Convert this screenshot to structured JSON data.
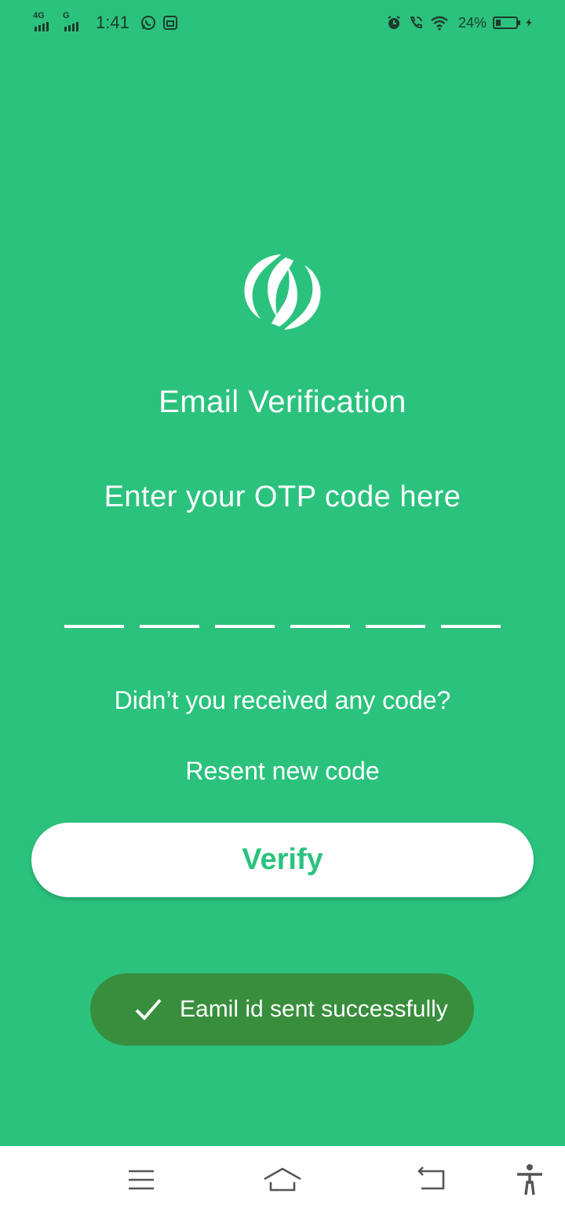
{
  "status_bar": {
    "network_1": "4G",
    "network_2": "G",
    "time": "1:41",
    "battery_percent": "24%",
    "battery_level": 0.24,
    "icons": [
      "whatsapp-icon",
      "message-icon",
      "alarm-icon",
      "wifi-call-icon",
      "wifi-icon",
      "battery-icon",
      "charging-icon"
    ]
  },
  "main": {
    "logo": "app-logo",
    "title": "Email Verification",
    "subtitle": "Enter your OTP code here",
    "otp_digits": [
      "",
      "",
      "",
      "",
      "",
      ""
    ],
    "hint": "Didn’t you received any code?",
    "resend_label": "Resent new code",
    "verify_label": "Verify"
  },
  "toast": {
    "icon": "check-icon",
    "message": "Eamil id sent successfully"
  },
  "nav_bar": {
    "icons": [
      "menu-icon",
      "home-icon",
      "back-icon",
      "accessibility-icon"
    ]
  },
  "colors": {
    "background": "#2bc27e",
    "button_bg": "#ffffff",
    "button_text": "#2bc27e",
    "toast_bg": "#388e3c",
    "status_text": "#1d3b2c",
    "nav_bg": "#ffffff"
  }
}
